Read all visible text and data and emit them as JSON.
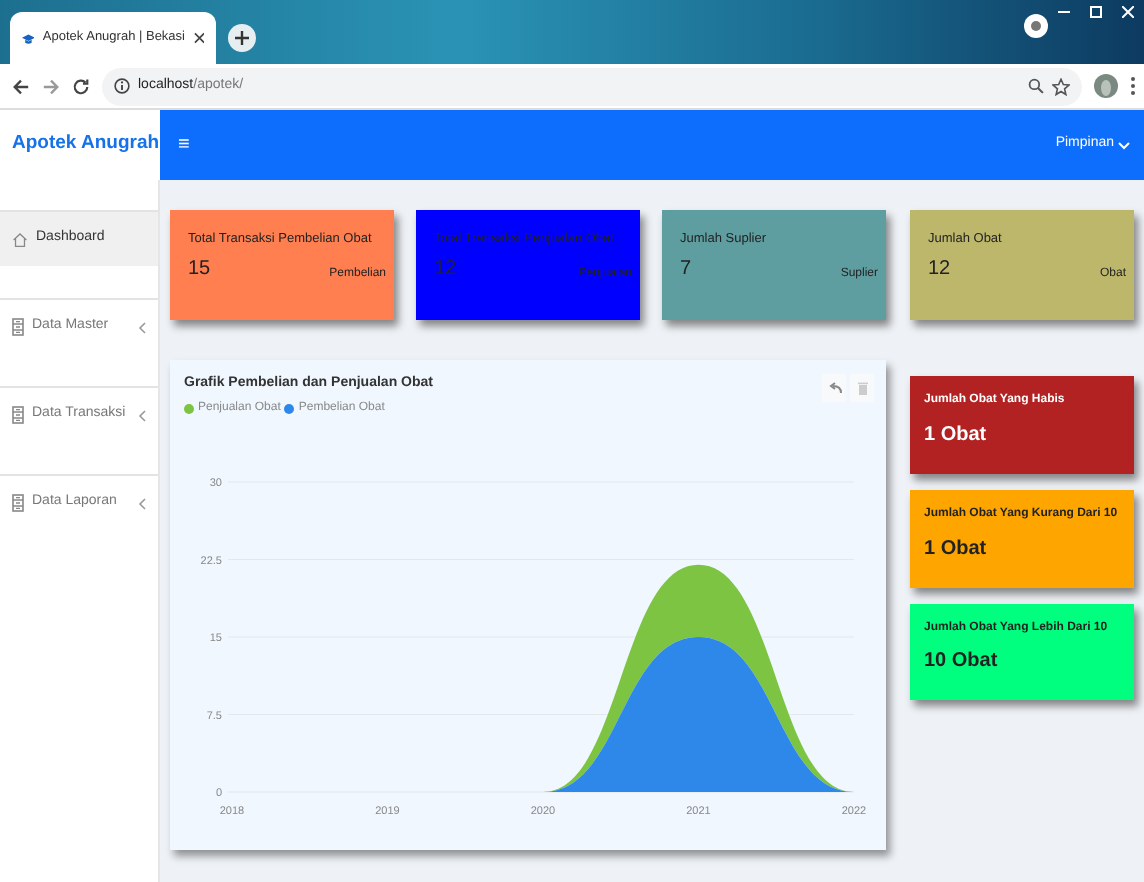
{
  "browser": {
    "tab_title": "Apotek Anugrah | Bekasi",
    "url_host": "localhost",
    "url_path": "/apotek/"
  },
  "brand": "Apotek Anugrah",
  "navbar": {
    "menu_glyph": "≡",
    "user": "Pimpinan"
  },
  "sidebar": {
    "items": [
      {
        "label": "Dashboard",
        "selected": true,
        "kind": "home"
      },
      {
        "label": "Data Master",
        "selected": false,
        "kind": "group"
      },
      {
        "label": "Data Transaksi",
        "selected": false,
        "kind": "group"
      },
      {
        "label": "Data Laporan",
        "selected": false,
        "kind": "group"
      }
    ]
  },
  "summary_cards": [
    {
      "title": "Total Transaksi Pembelian Obat",
      "value": "15",
      "unit": "Pembelian",
      "color": "#ff7f50"
    },
    {
      "title": "Total Transaksi Penjualan Obat",
      "value": "12",
      "unit": "Penjualan",
      "color": "#0000ff"
    },
    {
      "title": "Jumlah Suplier",
      "value": "7",
      "unit": "Suplier",
      "color": "#5f9ea0"
    },
    {
      "title": "Jumlah Obat",
      "value": "12",
      "unit": "Obat",
      "color": "#bdb76b"
    }
  ],
  "stock_cards": [
    {
      "title": "Jumlah Obat Yang Habis",
      "value": "1 Obat",
      "color": "#b22222"
    },
    {
      "title": "Jumlah Obat Yang Kurang Dari 10",
      "value": "1 Obat",
      "color": "#ffa500"
    },
    {
      "title": "Jumlah Obat Yang Lebih Dari 10",
      "value": "10 Obat",
      "color": "#00ff7f"
    }
  ],
  "chart": {
    "chart_data": {
      "type": "area",
      "title": "Grafik Pembelian dan Penjualan Obat",
      "stacked": true,
      "grid": true,
      "categories": [
        "2018",
        "2019",
        "2020",
        "2021",
        "2022"
      ],
      "series": [
        {
          "name": "Penjualan Obat",
          "color": "#7dc443",
          "values": [
            0,
            0,
            0,
            7,
            0
          ]
        },
        {
          "name": "Pembelian Obat",
          "color": "#2e88ea",
          "values": [
            0,
            0,
            0,
            15,
            0
          ]
        }
      ],
      "ylim": [
        0,
        30
      ],
      "yticks": [
        0,
        7.5,
        15,
        22.5,
        30
      ]
    }
  }
}
